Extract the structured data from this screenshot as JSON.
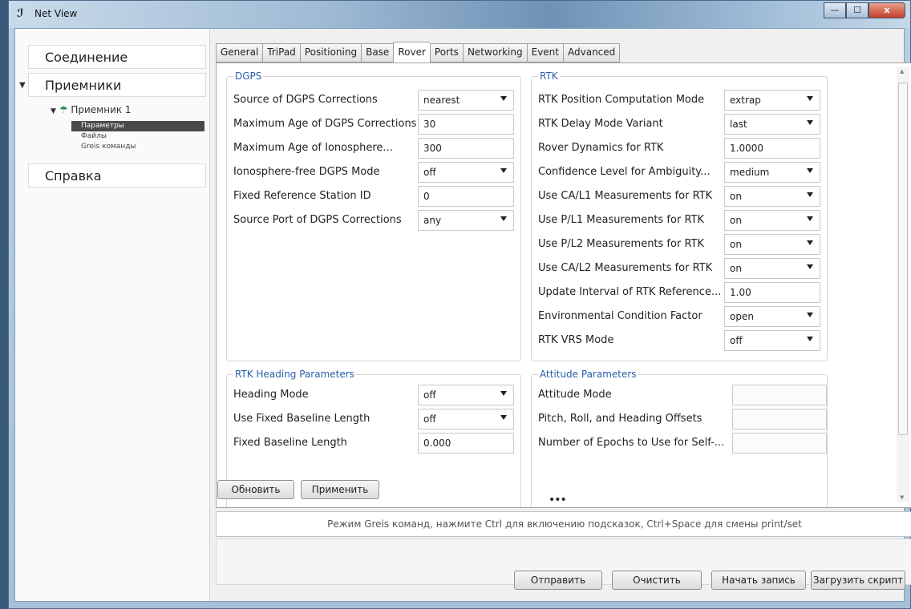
{
  "window": {
    "title": "Net View",
    "minimize": "—",
    "maximize": "☐",
    "close": "x"
  },
  "sidebar": {
    "connection": "Соединение",
    "receivers": "Приемники",
    "receiver1": "Приемник 1",
    "sub_items": [
      "Параметры",
      "Файлы",
      "Greis команды"
    ],
    "help": "Справка"
  },
  "tabs": [
    "General",
    "TriPad",
    "Positioning",
    "Base",
    "Rover",
    "Ports",
    "Networking",
    "Event",
    "Advanced"
  ],
  "active_tab": "Rover",
  "dgps": {
    "title": "DGPS",
    "rows": [
      {
        "label": "Source of DGPS Corrections",
        "value": "nearest",
        "dropdown": true
      },
      {
        "label": "Maximum Age of DGPS Corrections",
        "value": "30",
        "dropdown": false
      },
      {
        "label": "Maximum Age of Ionosphere...",
        "value": "300",
        "dropdown": false
      },
      {
        "label": "Ionosphere-free DGPS Mode",
        "value": "off",
        "dropdown": true
      },
      {
        "label": "Fixed Reference Station ID",
        "value": "0",
        "dropdown": false
      },
      {
        "label": "Source Port of DGPS Corrections",
        "value": "any",
        "dropdown": true
      }
    ]
  },
  "rtk": {
    "title": "RTK",
    "rows": [
      {
        "label": "RTK Position Computation Mode",
        "value": "extrap",
        "dropdown": true
      },
      {
        "label": "RTK Delay Mode Variant",
        "value": "last",
        "dropdown": true
      },
      {
        "label": "Rover Dynamics for RTK",
        "value": "1.0000",
        "dropdown": false
      },
      {
        "label": "Confidence Level for Ambiguity...",
        "value": "medium",
        "dropdown": true
      },
      {
        "label": "Use CA/L1 Measurements for RTK",
        "value": "on",
        "dropdown": true
      },
      {
        "label": "Use P/L1 Measurements for RTK",
        "value": "on",
        "dropdown": true
      },
      {
        "label": "Use P/L2 Measurements for RTK",
        "value": "on",
        "dropdown": true
      },
      {
        "label": "Use CA/L2 Measurements for RTK",
        "value": "on",
        "dropdown": true
      },
      {
        "label": "Update Interval of RTK Reference...",
        "value": "1.00",
        "dropdown": false
      },
      {
        "label": "Environmental Condition Factor",
        "value": "open",
        "dropdown": true
      },
      {
        "label": "RTK VRS Mode",
        "value": "off",
        "dropdown": true
      }
    ]
  },
  "heading": {
    "title": "RTK Heading Parameters",
    "rows": [
      {
        "label": "Heading Mode",
        "value": "off",
        "dropdown": true
      },
      {
        "label": "Use Fixed Baseline Length",
        "value": "off",
        "dropdown": true
      },
      {
        "label": "Fixed Baseline Length",
        "value": "0.000",
        "dropdown": false
      }
    ]
  },
  "attitude": {
    "title": "Attitude Parameters",
    "rows": [
      {
        "label": "Attitude Mode",
        "value": ""
      },
      {
        "label": "Pitch, Roll, and Heading Offsets",
        "value": ""
      },
      {
        "label": "Number of Epochs to Use for Self-...",
        "value": ""
      }
    ]
  },
  "buttons": {
    "refresh": "Обновить",
    "apply": "Применить",
    "send": "Отправить",
    "clear": "Очистить",
    "start_record": "Начать запись",
    "load_script": "Загрузить скрипт"
  },
  "splitter_dots": "•••",
  "command_hint": "Режим Greis команд, нажмите  Ctrl для включению подсказок, Ctrl+Space для смены print/set"
}
